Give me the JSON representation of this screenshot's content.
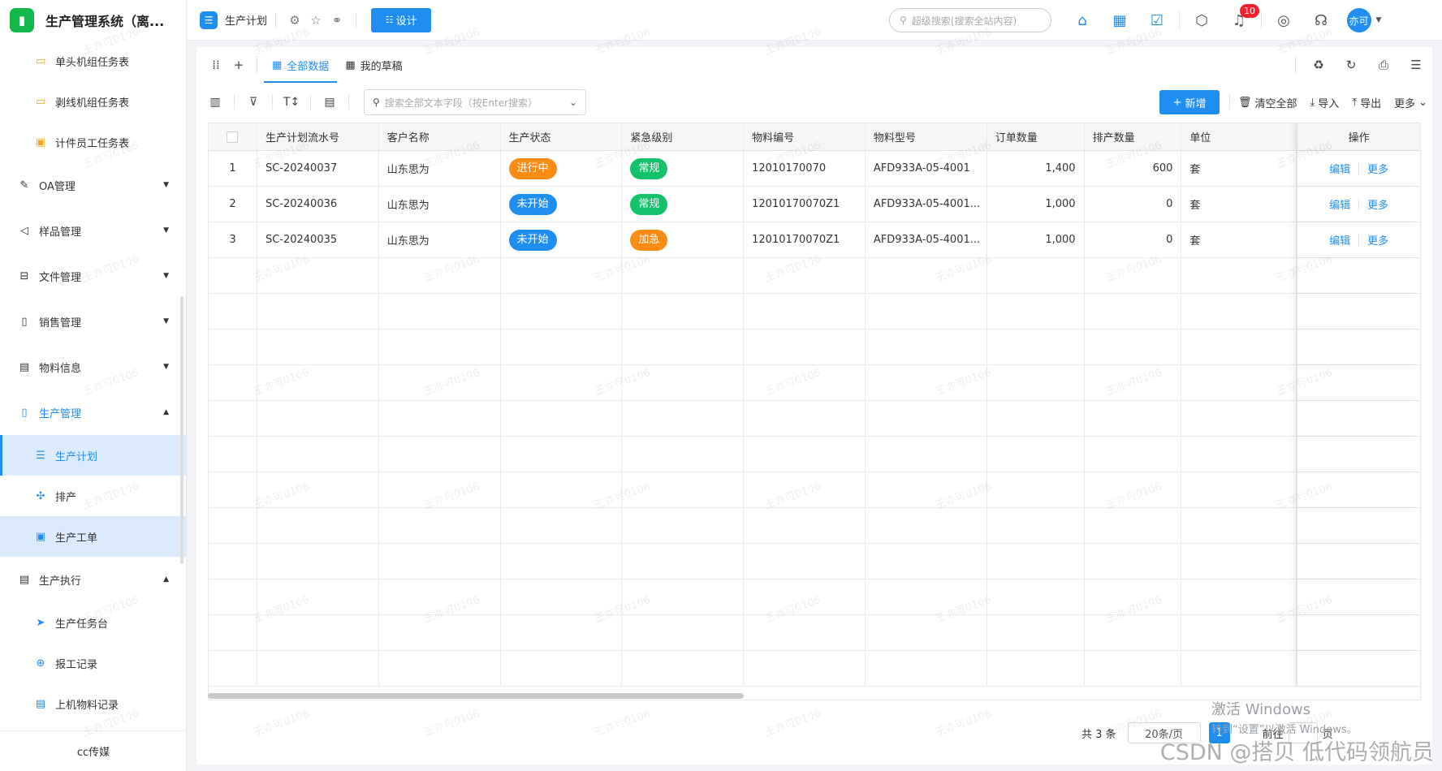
{
  "app": {
    "title": "生产管理系统（离..."
  },
  "sidebar": {
    "items": [
      {
        "label": "单头机组任务表",
        "level": "sub",
        "icon": "folder-icon"
      },
      {
        "label": "剥线机组任务表",
        "level": "sub",
        "icon": "folder-icon"
      },
      {
        "label": "计件员工任务表",
        "level": "sub",
        "icon": "clipboard-icon"
      },
      {
        "label": "OA管理",
        "level": "group",
        "icon": "document-edit-icon"
      },
      {
        "label": "样品管理",
        "level": "group",
        "icon": "megaphone-icon"
      },
      {
        "label": "文件管理",
        "level": "group",
        "icon": "file-box-icon"
      },
      {
        "label": "销售管理",
        "level": "group",
        "icon": "book-icon"
      },
      {
        "label": "物料信息",
        "level": "group",
        "icon": "message-icon"
      },
      {
        "label": "生产管理",
        "level": "group",
        "icon": "book-icon"
      },
      {
        "label": "生产计划",
        "level": "sub",
        "icon": "list-icon"
      },
      {
        "label": "排产",
        "level": "sub",
        "icon": "puzzle-icon"
      },
      {
        "label": "生产工单",
        "level": "sub",
        "icon": "clipboard-icon"
      },
      {
        "label": "生产执行",
        "level": "group",
        "icon": "notes-icon"
      },
      {
        "label": "生产任务台",
        "level": "sub",
        "icon": "send-icon"
      },
      {
        "label": "报工记录",
        "level": "sub",
        "icon": "target-icon"
      },
      {
        "label": "上机物料记录",
        "level": "sub",
        "icon": "doc-icon"
      }
    ],
    "footer": "cc传媒"
  },
  "topbar": {
    "page_name": "生产计划",
    "design_label": "设计",
    "search_placeholder": "超级搜索(搜索全站内容)",
    "notification_count": "10",
    "avatar_text": "亦可"
  },
  "views": {
    "tab_all": "全部数据",
    "tab_drafts": "我的草稿"
  },
  "toolbar": {
    "search_placeholder": "搜索全部文本字段（按Enter搜索）",
    "add_label": "新增",
    "clear_label": "清空全部",
    "import_label": "导入",
    "export_label": "导出",
    "more_label": "更多"
  },
  "table": {
    "columns": [
      "生产计划流水号",
      "客户名称",
      "生产状态",
      "紧急级别",
      "物料编号",
      "物料型号",
      "订单数量",
      "排产数量",
      "单位",
      "操作"
    ],
    "rows": [
      {
        "index": "1",
        "serial": "SC-20240037",
        "customer": "山东思为",
        "status": "进行中",
        "urgency": "常规",
        "material_no": "12010170070",
        "model": "AFD933A-05-4001",
        "order_qty": "1,400",
        "sched_qty": "600",
        "unit": "套"
      },
      {
        "index": "2",
        "serial": "SC-20240036",
        "customer": "山东思为",
        "status": "未开始",
        "urgency": "常规",
        "material_no": "12010170070Z1",
        "model": "AFD933A-05-4001...",
        "order_qty": "1,000",
        "sched_qty": "0",
        "unit": "套"
      },
      {
        "index": "3",
        "serial": "SC-20240035",
        "customer": "山东思为",
        "status": "未开始",
        "urgency": "加急",
        "material_no": "12010170070Z1",
        "model": "AFD933A-05-4001...",
        "order_qty": "1,000",
        "sched_qty": "0",
        "unit": "套"
      }
    ],
    "edit_label": "编辑",
    "more_label": "更多"
  },
  "colors": {
    "accent": "#1f8ef1",
    "status_in_progress": "#fa8c16",
    "status_not_started": "#1f8ef1",
    "urgency_normal": "#13c26b",
    "urgency_urgent": "#fa8c16"
  },
  "pagination": {
    "total": "共 3 条",
    "page_size": "20条/页",
    "current_page": "1",
    "goto_label": "前往",
    "page_label": "页"
  },
  "overlay": {
    "activate_title": "激活 Windows",
    "activate_sub": "转到“设置”以激活 Windows。",
    "csdn": "CSDN @搭贝 低代码领航员",
    "watermark": "王亦可0106"
  }
}
